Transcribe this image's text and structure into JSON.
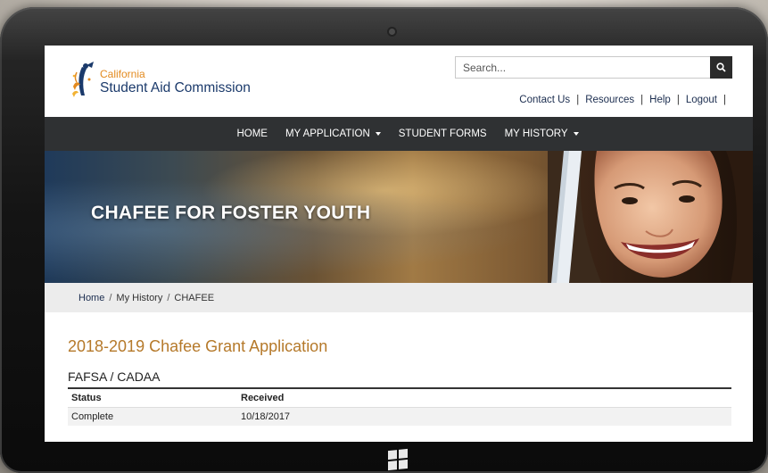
{
  "header": {
    "logo_small": "California",
    "logo_large": "Student Aid Commission",
    "search_placeholder": "Search...",
    "util_links": [
      "Contact Us",
      "Resources",
      "Help",
      "Logout"
    ],
    "util_separator": "|"
  },
  "nav": {
    "items": [
      {
        "label": "HOME",
        "dropdown": false
      },
      {
        "label": "MY APPLICATION",
        "dropdown": true
      },
      {
        "label": "STUDENT FORMS",
        "dropdown": false
      },
      {
        "label": "MY HISTORY",
        "dropdown": true
      }
    ]
  },
  "hero": {
    "title": "CHAFEE FOR FOSTER YOUTH"
  },
  "breadcrumb": {
    "items": [
      "Home",
      "My History",
      "CHAFEE"
    ],
    "separator": "/"
  },
  "main": {
    "page_title": "2018-2019 Chafee Grant Application",
    "section_title": "FAFSA / CADAA",
    "table": {
      "headers": [
        "Status",
        "Received"
      ],
      "rows": [
        [
          "Complete",
          "10/18/2017"
        ]
      ]
    }
  },
  "colors": {
    "nav_bg": "#2f3133",
    "heading_accent": "#b5792a",
    "logo_blue": "#1b3a6b",
    "logo_orange": "#e38a1f"
  },
  "icons": {
    "search": "search-icon",
    "windows": "windows-logo-icon",
    "logo": "california-poppy-logo"
  }
}
